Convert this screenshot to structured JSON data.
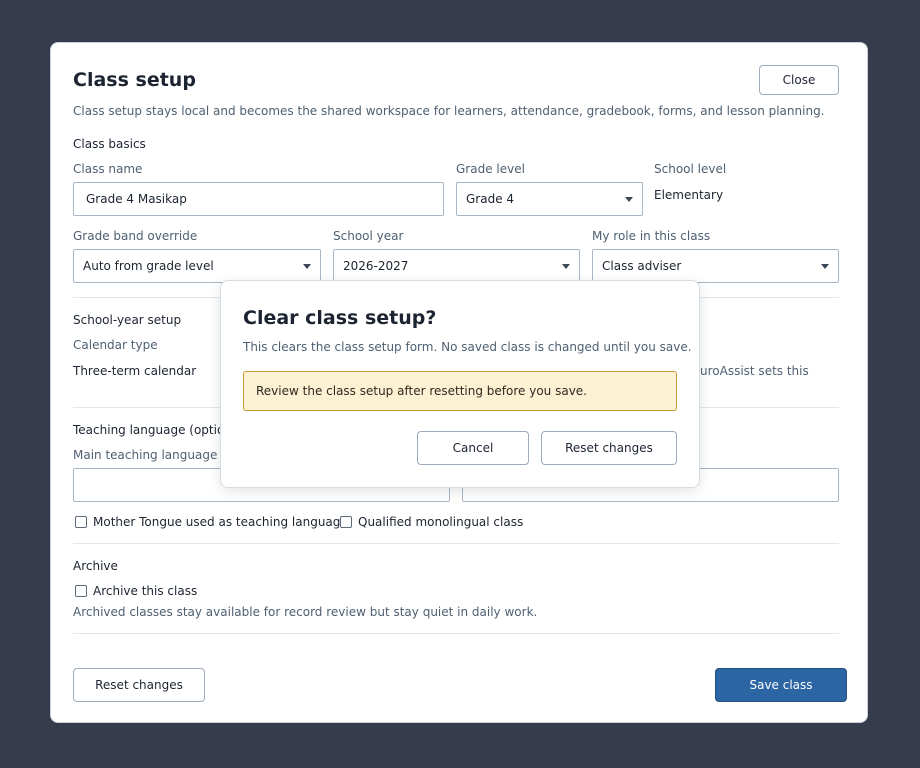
{
  "dialog": {
    "title": "Class setup",
    "subtitle": "Class setup stays local and becomes the shared workspace for learners, attendance, gradebook, forms, and lesson planning.",
    "close_label": "Close"
  },
  "basics": {
    "heading": "Class basics",
    "class_name_label": "Class name",
    "class_name_value": "Grade 4 Masikap",
    "grade_level_label": "Grade level",
    "grade_level_value": "Grade 4",
    "school_level_label": "School level",
    "school_level_value": "Elementary",
    "grade_band_label": "Grade band override",
    "grade_band_value": "Auto from grade level",
    "school_year_label": "School year",
    "school_year_value": "2026-2027",
    "role_label": "My role in this class",
    "role_value": "Class adviser"
  },
  "school_year": {
    "heading": "School-year setup",
    "calendar_type_label": "Calendar type",
    "calendar_type_value": "Three-term calendar",
    "partial_note": "uroAssist sets this"
  },
  "language": {
    "heading": "Teaching language (optiona",
    "main_label": "Main teaching language",
    "main_value": "",
    "secondary_value": "",
    "mother_tongue_label": "Mother Tongue used as teaching language",
    "mother_tongue_checked": false,
    "monolingual_label": "Qualified monolingual class",
    "monolingual_checked": false
  },
  "archive": {
    "heading": "Archive",
    "checkbox_label": "Archive this class",
    "checked": false,
    "hint": "Archived classes stay available for record review but stay quiet in daily work."
  },
  "footer": {
    "reset_label": "Reset changes",
    "save_label": "Save class"
  },
  "confirm": {
    "title": "Clear class setup?",
    "message": "This clears the class setup form. No saved class is changed until you save.",
    "warning": "Review the class setup after resetting before you save.",
    "cancel_label": "Cancel",
    "reset_label": "Reset changes"
  },
  "colors": {
    "backdrop": "#363c4b",
    "primary": "#2c65a4",
    "warning_bg": "#fdf1d3",
    "warning_border": "#c69a35"
  }
}
